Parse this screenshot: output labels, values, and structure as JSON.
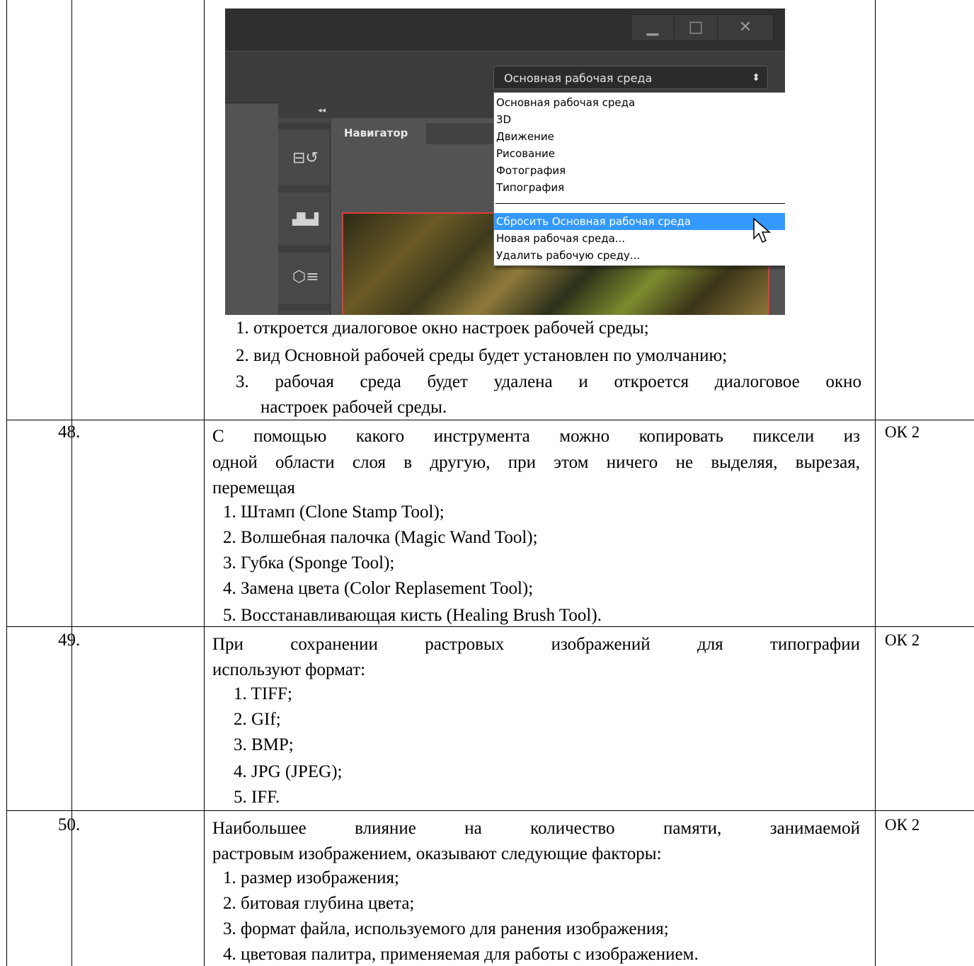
{
  "screenshot": {
    "window_controls": [
      "▁",
      "□",
      "✕"
    ],
    "workspace_select": "Основная рабочая среда",
    "panel_tab": "Навигатор",
    "collapse_arrows": "◂◂",
    "menu": {
      "items": [
        "Основная рабочая среда",
        "3D",
        "Движение",
        "Рисование",
        "Фотография",
        "Типография"
      ],
      "actions": [
        "Сбросить Основная рабочая среда",
        "Новая рабочая среда...",
        "Удалить рабочую среду..."
      ],
      "selected": "Сбросить Основная рабочая среда"
    },
    "dock_icons": [
      "history-icon",
      "levels-icon",
      "3d-icon"
    ]
  },
  "q47_options": [
    "1. откроется диалоговое окно настроек рабочей среды;",
    "2. вид Основной рабочей среды будет установлен по умолчанию;",
    "3. рабочая среда будет удалена и откроется диалоговое окно",
    "настроек рабочей среды."
  ],
  "questions": [
    {
      "num": "48.",
      "ok": "ОК 2",
      "text_lines": [
        "С помощью какого инструмента можно копировать пиксели из",
        "одной области слоя в другую, при этом ничего не выделяя, вырезая,",
        "перемещая"
      ],
      "options": [
        "1.   Штамп (Clone Stamp Tool);",
        "2.   Волшебная палочка (Magic Wand Tool);",
        "3.   Губка (Sponge Tool);",
        "4.   Замена цвета (Color Replasement Tool);",
        "5.   Восстанавливающая кисть (Healing Brush Tool)."
      ]
    },
    {
      "num": "49.",
      "ok": "ОК 2",
      "text_lines": [
        "При сохранении растровых изображений для типографии",
        "используют формат:"
      ],
      "options": [
        "1. TIFF;",
        "2. GIf;",
        "3. BMP;",
        "4. JPG (JPEG);",
        "5. IFF."
      ]
    },
    {
      "num": "50.",
      "ok": "ОК 2",
      "text_lines": [
        "Наибольшее влияние на количество памяти, занимаемой",
        "растровым изображением, оказывают следующие факторы:"
      ],
      "options": [
        "1. размер изображения;",
        "2. битовая глубина цвета;",
        "3. формат файла, используемого для ранения изображения;",
        "4. цветовая палитра, применяемая для работы с изображением."
      ]
    }
  ]
}
